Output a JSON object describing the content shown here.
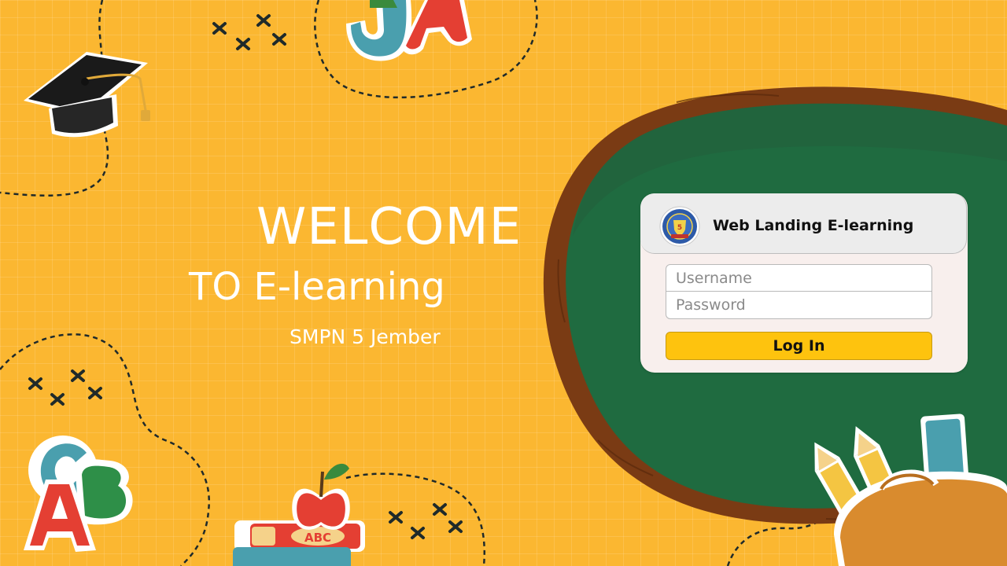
{
  "welcome": {
    "title": "WELCOME",
    "subtitle": "TO E-learning",
    "school": "SMPN 5 Jember"
  },
  "login": {
    "title": "Web Landing E-learning",
    "username_placeholder": "Username",
    "password_placeholder": "Password",
    "button_label": "Log In",
    "logo_label": "5"
  },
  "decor": {
    "letters_top": [
      "J",
      "A"
    ],
    "letters_bottom_left": [
      "C",
      "B",
      "A"
    ],
    "book_label": "ABC"
  },
  "colors": {
    "background": "#fbb731",
    "chalkboard": "#1f6b40",
    "frame": "#7a3b14",
    "button": "#fec30e",
    "card": "#f8efed"
  }
}
